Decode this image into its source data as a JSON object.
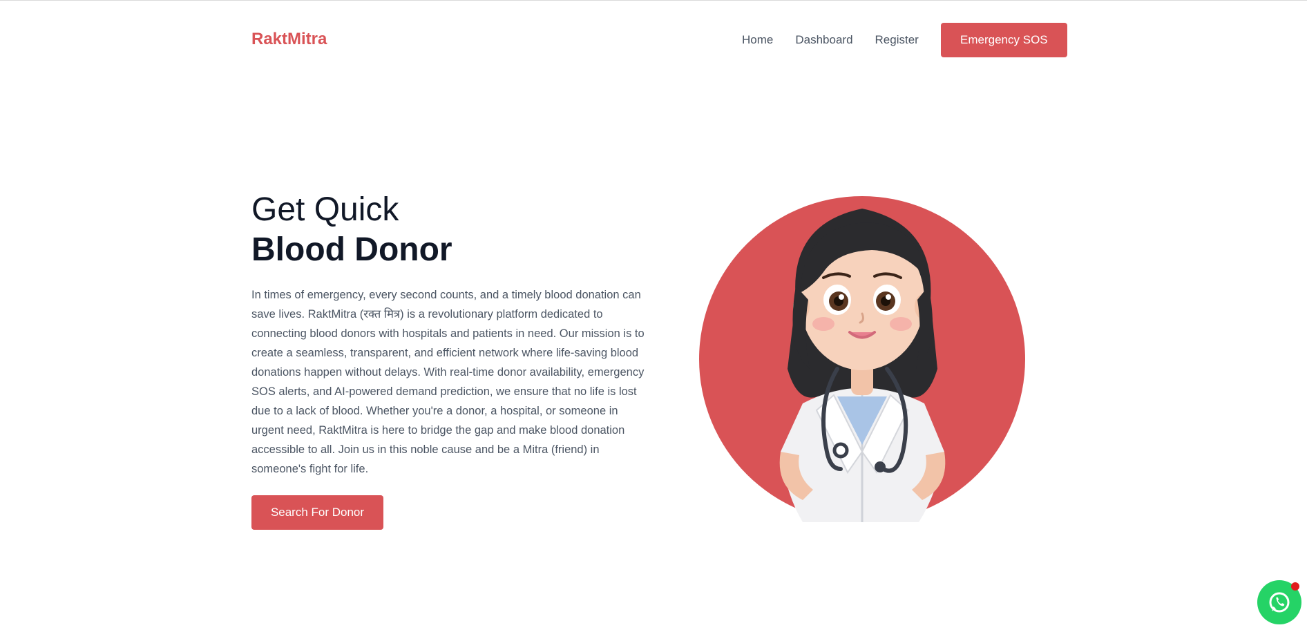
{
  "brand": {
    "name": "RaktMitra",
    "color": "#d95356"
  },
  "nav": {
    "items": [
      {
        "label": "Home"
      },
      {
        "label": "Dashboard"
      },
      {
        "label": "Register"
      }
    ],
    "sos_label": "Emergency SOS"
  },
  "hero": {
    "title_line1": "Get Quick",
    "title_line2": "Blood Donor",
    "description": "In times of emergency, every second counts, and a timely blood donation can save lives. RaktMitra (रक्त मित्र) is a revolutionary platform dedicated to connecting blood donors with hospitals and patients in need. Our mission is to create a seamless, transparent, and efficient network where life-saving blood donations happen without delays. With real-time donor availability, emergency SOS alerts, and AI-powered demand prediction, we ensure that no life is lost due to a lack of blood. Whether you're a donor, a hospital, or someone in urgent need, RaktMitra is here to bridge the gap and make blood donation accessible to all. Join us in this noble cause and be a Mitra (friend) in someone's fight for life.",
    "cta_label": "Search For Donor"
  },
  "illustration": {
    "subject": "doctor-illustration",
    "bg_color": "#d95356"
  },
  "whatsapp": {
    "icon": "whatsapp-icon",
    "color": "#25d366"
  }
}
